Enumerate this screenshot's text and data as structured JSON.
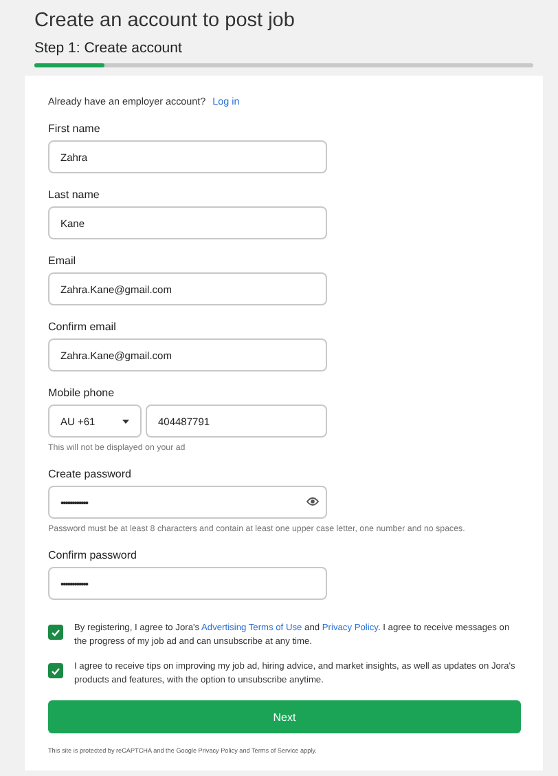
{
  "page": {
    "title": "Create an account to post job",
    "step": "Step 1: Create account",
    "progress": {
      "level": 0.14
    }
  },
  "login_prompt": {
    "text": "Already have an employer account?",
    "link": "Log in"
  },
  "fields": [
    {
      "kind": "text",
      "label": "First name",
      "value": "Zahra"
    },
    {
      "kind": "text",
      "label": "Last name",
      "value": "Kane"
    },
    {
      "kind": "text",
      "label": "Email",
      "value": "Zahra.Kane@gmail.com"
    },
    {
      "kind": "text",
      "label": "Confirm email",
      "value": "Zahra.Kane@gmail.com"
    },
    {
      "kind": "phone",
      "label": "Mobile phone",
      "country": "AU +61",
      "value": "404487791",
      "hint": "This will not be displayed on your ad"
    },
    {
      "kind": "password",
      "label": "Create password",
      "value": "••••••••••••",
      "hint": "Password must be at least 8 characters and contain at least one upper case letter, one number and no spaces."
    },
    {
      "kind": "password",
      "label": "Confirm password",
      "value": "••••••••••••"
    }
  ],
  "consents": [
    {
      "checked": true,
      "parts": [
        {
          "kind": "text",
          "text": "By registering, I agree to Jora's"
        },
        {
          "kind": "link",
          "text": "Advertising Terms of Use"
        },
        {
          "kind": "text",
          "text": "and"
        },
        {
          "kind": "link",
          "text": "Privacy Policy"
        },
        {
          "kind": "text",
          "text": ". I agree to receive messages on the progress of my job ad and can unsubscribe at any time."
        }
      ]
    },
    {
      "checked": true,
      "parts": [
        {
          "kind": "text",
          "text": "I agree to receive tips on improving my job ad, hiring advice, and market insights, as well as updates on Jora's products and features, with the option to unsubscribe anytime."
        }
      ]
    }
  ],
  "next_button": "Next",
  "footer": "This site is protected by reCAPTCHA and the Google Privacy Policy and Terms of Service apply."
}
